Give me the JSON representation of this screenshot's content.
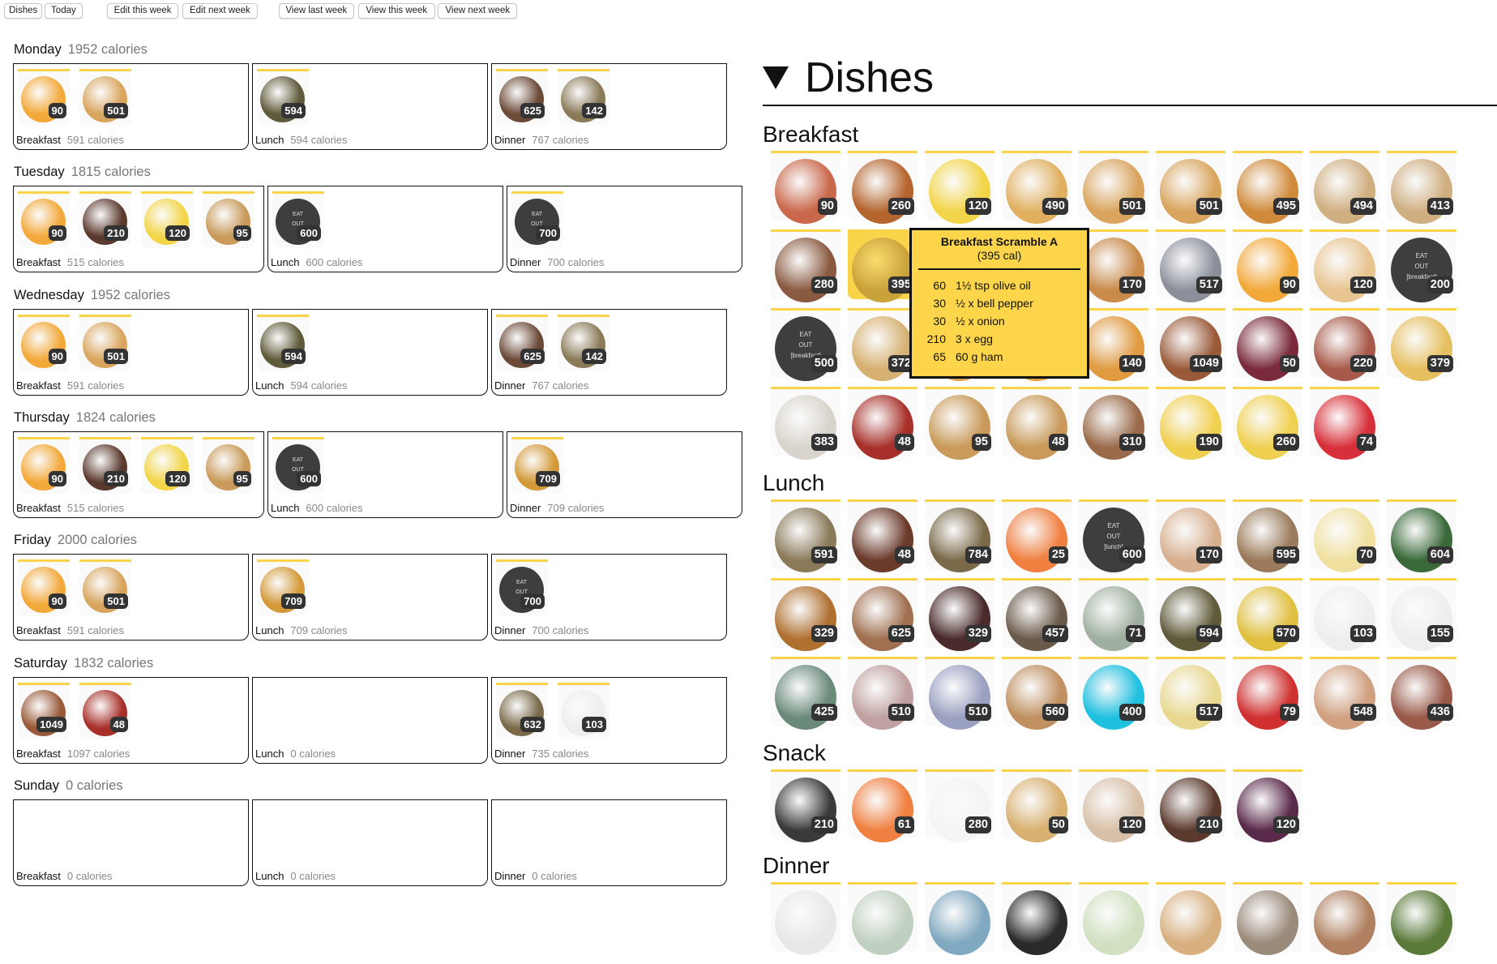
{
  "toolbar": {
    "buttons": [
      "Dishes",
      "Today",
      "Edit this week",
      "Edit next week",
      "View last week",
      "View this week",
      "View next week"
    ]
  },
  "week": [
    {
      "day": "Monday",
      "calories": "1952 calories",
      "meals": [
        {
          "name": "Breakfast",
          "calories": "591 calories",
          "items": [
            {
              "kcal": "90",
              "color": "#f3a93a"
            },
            {
              "kcal": "501",
              "color": "#d9a55e"
            }
          ]
        },
        {
          "name": "Lunch",
          "calories": "594 calories",
          "items": [
            {
              "kcal": "594",
              "color": "#5f5a3a"
            }
          ]
        },
        {
          "name": "Dinner",
          "calories": "767 calories",
          "items": [
            {
              "kcal": "625",
              "color": "#6b4a38"
            },
            {
              "kcal": "142",
              "color": "#8a7a58"
            }
          ]
        }
      ]
    },
    {
      "day": "Tuesday",
      "calories": "1815 calories",
      "meals": [
        {
          "name": "Breakfast",
          "calories": "515 calories",
          "items": [
            {
              "kcal": "90",
              "color": "#f3a93a"
            },
            {
              "kcal": "210",
              "color": "#5b3a2e"
            },
            {
              "kcal": "120",
              "color": "#f2d548"
            },
            {
              "kcal": "95",
              "color": "#c99a5a"
            }
          ]
        },
        {
          "name": "Lunch",
          "calories": "600 calories",
          "items": [
            {
              "kcal": "600",
              "eatout": [
                "EAT",
                "OUT"
              ]
            }
          ]
        },
        {
          "name": "Dinner",
          "calories": "700 calories",
          "items": [
            {
              "kcal": "700",
              "eatout": [
                "EAT",
                "OUT"
              ]
            }
          ]
        }
      ]
    },
    {
      "day": "Wednesday",
      "calories": "1952 calories",
      "meals": [
        {
          "name": "Breakfast",
          "calories": "591 calories",
          "items": [
            {
              "kcal": "90",
              "color": "#f3a93a"
            },
            {
              "kcal": "501",
              "color": "#d9a55e"
            }
          ]
        },
        {
          "name": "Lunch",
          "calories": "594 calories",
          "items": [
            {
              "kcal": "594",
              "color": "#5f5a3a"
            }
          ]
        },
        {
          "name": "Dinner",
          "calories": "767 calories",
          "items": [
            {
              "kcal": "625",
              "color": "#6b4a38"
            },
            {
              "kcal": "142",
              "color": "#8a7a58"
            }
          ]
        }
      ]
    },
    {
      "day": "Thursday",
      "calories": "1824 calories",
      "meals": [
        {
          "name": "Breakfast",
          "calories": "515 calories",
          "items": [
            {
              "kcal": "90",
              "color": "#f3a93a"
            },
            {
              "kcal": "210",
              "color": "#5b3a2e"
            },
            {
              "kcal": "120",
              "color": "#f2d548"
            },
            {
              "kcal": "95",
              "color": "#c99a5a"
            }
          ]
        },
        {
          "name": "Lunch",
          "calories": "600 calories",
          "items": [
            {
              "kcal": "600",
              "eatout": [
                "EAT",
                "OUT"
              ]
            }
          ]
        },
        {
          "name": "Dinner",
          "calories": "709 calories",
          "items": [
            {
              "kcal": "709",
              "color": "#d49a3a"
            }
          ]
        }
      ]
    },
    {
      "day": "Friday",
      "calories": "2000 calories",
      "meals": [
        {
          "name": "Breakfast",
          "calories": "591 calories",
          "items": [
            {
              "kcal": "90",
              "color": "#f3a93a"
            },
            {
              "kcal": "501",
              "color": "#d9a55e"
            }
          ]
        },
        {
          "name": "Lunch",
          "calories": "709 calories",
          "items": [
            {
              "kcal": "709",
              "color": "#d49a3a"
            }
          ]
        },
        {
          "name": "Dinner",
          "calories": "700 calories",
          "items": [
            {
              "kcal": "700",
              "eatout": [
                "EAT",
                "OUT"
              ]
            }
          ]
        }
      ]
    },
    {
      "day": "Saturday",
      "calories": "1832 calories",
      "meals": [
        {
          "name": "Breakfast",
          "calories": "1097 calories",
          "items": [
            {
              "kcal": "1049",
              "color": "#9a5a3a"
            },
            {
              "kcal": "48",
              "color": "#a8302a"
            }
          ]
        },
        {
          "name": "Lunch",
          "calories": "0 calories",
          "items": []
        },
        {
          "name": "Dinner",
          "calories": "735 calories",
          "items": [
            {
              "kcal": "632",
              "color": "#7a6a4a"
            },
            {
              "kcal": "103",
              "color": "#eeeeee"
            }
          ]
        }
      ]
    },
    {
      "day": "Sunday",
      "calories": "0 calories",
      "meals": [
        {
          "name": "Breakfast",
          "calories": "0 calories",
          "items": []
        },
        {
          "name": "Lunch",
          "calories": "0 calories",
          "items": []
        },
        {
          "name": "Dinner",
          "calories": "0 calories",
          "items": []
        }
      ]
    }
  ],
  "dishes": {
    "title": "Dishes",
    "sections": [
      {
        "name": "Breakfast",
        "items": [
          {
            "kcal": "90",
            "color": "#c9684a"
          },
          {
            "kcal": "260",
            "color": "#b5652e"
          },
          {
            "kcal": "120",
            "color": "#f2d548"
          },
          {
            "kcal": "490",
            "color": "#e0b060"
          },
          {
            "kcal": "501",
            "color": "#d9a55e"
          },
          {
            "kcal": "501",
            "color": "#d9a55e"
          },
          {
            "kcal": "495",
            "color": "#d08a3a"
          },
          {
            "kcal": "494",
            "color": "#cfae80"
          },
          {
            "kcal": "413",
            "color": "#cfae80"
          },
          {
            "kcal": "280",
            "color": "#8a5a40"
          },
          {
            "kcal": "395",
            "color": "#c9a23a",
            "highlight": true
          },
          {
            "color": "#e6b04a"
          },
          {
            "color": "#e09a40"
          },
          {
            "kcal": "170",
            "color": "#c98a4a"
          },
          {
            "kcal": "517",
            "color": "#8a8f9a"
          },
          {
            "kcal": "90",
            "color": "#f3a93a"
          },
          {
            "kcal": "120",
            "color": "#e8c490"
          },
          {
            "kcal": "200",
            "eatout": [
              "EAT",
              "OUT",
              "[breakfast]"
            ]
          },
          {
            "kcal": "500",
            "eatout": [
              "EAT",
              "OUT",
              "[breakfast]"
            ]
          },
          {
            "kcal": "372",
            "color": "#d6b070"
          },
          {
            "color": "#d8a050"
          },
          {
            "color": "#e0a040"
          },
          {
            "kcal": "140",
            "color": "#e09a40"
          },
          {
            "kcal": "1049",
            "color": "#9a5a3a"
          },
          {
            "kcal": "50",
            "color": "#7a2a3a"
          },
          {
            "kcal": "220",
            "color": "#a85a4a"
          },
          {
            "kcal": "379",
            "color": "#e6c060"
          },
          {
            "kcal": "383",
            "color": "#d8d4cc"
          },
          {
            "kcal": "48",
            "color": "#a8302a"
          },
          {
            "kcal": "95",
            "color": "#c99a5a"
          },
          {
            "kcal": "48",
            "color": "#c99a5a"
          },
          {
            "kcal": "310",
            "color": "#9a6a4a"
          },
          {
            "kcal": "190",
            "color": "#f0d050"
          },
          {
            "kcal": "260",
            "color": "#f0d050"
          },
          {
            "kcal": "74",
            "color": "#d8303a"
          }
        ]
      },
      {
        "name": "Lunch",
        "items": [
          {
            "kcal": "591",
            "color": "#8a7a5a"
          },
          {
            "kcal": "48",
            "color": "#6a3a2a"
          },
          {
            "kcal": "784",
            "color": "#7a6a4a"
          },
          {
            "kcal": "25",
            "color": "#f08040"
          },
          {
            "kcal": "600",
            "eatout": [
              "EAT",
              "OUT",
              "[lunch]"
            ]
          },
          {
            "kcal": "170",
            "color": "#d8b090"
          },
          {
            "kcal": "595",
            "color": "#9a7a5a"
          },
          {
            "kcal": "70",
            "color": "#f0e0a0"
          },
          {
            "kcal": "604",
            "color": "#3a6a3a"
          },
          {
            "kcal": "329",
            "color": "#b07030"
          },
          {
            "kcal": "625",
            "color": "#a07050"
          },
          {
            "kcal": "329",
            "color": "#4a2a2a"
          },
          {
            "kcal": "457",
            "color": "#6a5a4a"
          },
          {
            "kcal": "71",
            "color": "#a0b0a0"
          },
          {
            "kcal": "594",
            "color": "#5f5a3a"
          },
          {
            "kcal": "570",
            "color": "#e0c040"
          },
          {
            "kcal": "103",
            "color": "#eeeeee"
          },
          {
            "kcal": "155",
            "color": "#eeeeee"
          },
          {
            "kcal": "425",
            "color": "#6a8a7a"
          },
          {
            "kcal": "510",
            "color": "#c0a0a0"
          },
          {
            "kcal": "510",
            "color": "#9aa0c0"
          },
          {
            "kcal": "560",
            "color": "#c09060"
          },
          {
            "kcal": "400",
            "color": "#20c0e0"
          },
          {
            "kcal": "517",
            "color": "#e8d890"
          },
          {
            "kcal": "79",
            "color": "#d03030"
          },
          {
            "kcal": "548",
            "color": "#d0a080"
          },
          {
            "kcal": "436",
            "color": "#9a5a4a"
          }
        ]
      },
      {
        "name": "Snack",
        "items": [
          {
            "kcal": "210",
            "color": "#3a3a3a"
          },
          {
            "kcal": "61",
            "color": "#f08040"
          },
          {
            "kcal": "280",
            "color": "#f4f4f4"
          },
          {
            "kcal": "50",
            "color": "#d8b070"
          },
          {
            "kcal": "120",
            "color": "#d8c0a8"
          },
          {
            "kcal": "210",
            "color": "#5b3a2e"
          },
          {
            "kcal": "120",
            "color": "#5a2a4a"
          }
        ]
      },
      {
        "name": "Dinner",
        "items": [
          {
            "color": "#e8e8e8"
          },
          {
            "color": "#c0d0c0"
          },
          {
            "color": "#80a8c0"
          },
          {
            "color": "#2a2a2a"
          },
          {
            "color": "#d0e0c0"
          },
          {
            "color": "#d8b080"
          },
          {
            "color": "#9a8a7a"
          },
          {
            "color": "#b08060"
          },
          {
            "color": "#5a7a3a"
          }
        ]
      }
    ]
  },
  "tooltip": {
    "title": "Breakfast Scramble A",
    "subtitle": "(395 cal)",
    "rows": [
      {
        "cal": "60",
        "item": "1½ tsp olive oil"
      },
      {
        "cal": "30",
        "item": "½ x bell pepper"
      },
      {
        "cal": "30",
        "item": "½ x onion"
      },
      {
        "cal": "210",
        "item": "3 x egg"
      },
      {
        "cal": "65",
        "item": "60 g ham"
      }
    ]
  },
  "colors": {
    "accent": "#f9d44a",
    "badge": "#333333",
    "eatout": "#3e3e3e"
  }
}
